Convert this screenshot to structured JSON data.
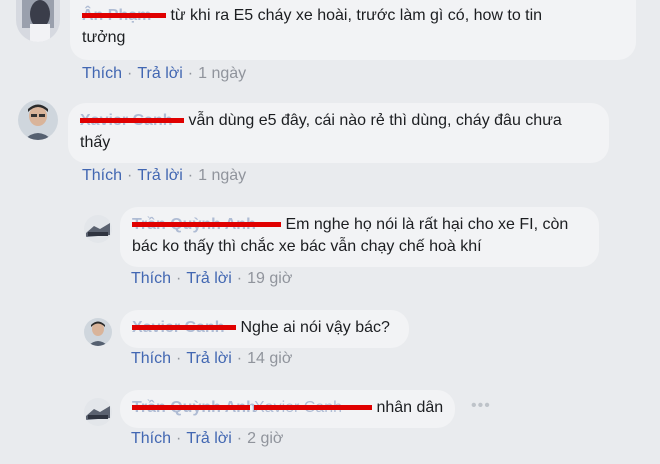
{
  "comments": [
    {
      "author": "Ân Phạm",
      "text_line1": "từ khi ra E5 cháy xe hoài, trước làm gì có, how to tin",
      "text_line2": "tưởng",
      "like": "Thích",
      "reply": "Trả lời",
      "time": "1 ngày"
    },
    {
      "author": "Xavier Canh",
      "text_line1": "vẫn dùng e5 đây, cái nào rẻ thì dùng, cháy đâu chưa",
      "text_line2": "thấy",
      "like": "Thích",
      "reply": "Trả lời",
      "time": "1 ngày"
    }
  ],
  "replies": [
    {
      "author": "Trần Quỳnh Anh",
      "text_line1": "Em nghe họ nói là rất hại cho xe FI, còn",
      "text_line2": "bác ko thấy thì chắc xe bác vẫn chạy chế hoà khí",
      "like": "Thích",
      "reply": "Trả lời",
      "time": "19 giờ"
    },
    {
      "author": "Xavier Canh",
      "text_line1": "Nghe ai nói vậy bác?",
      "like": "Thích",
      "reply": "Trả lời",
      "time": "14 giờ"
    },
    {
      "author": "Trần Quỳnh Anh",
      "tag": "Xavier Canh",
      "text_line1": "nhân dân",
      "like": "Thích",
      "reply": "Trả lời",
      "time": "2 giờ",
      "more_icon": "more-options-icon"
    }
  ],
  "separator": "·",
  "colors": {
    "background": "#e9ebee",
    "bubble": "#f2f3f5",
    "link": "#4267b2",
    "redaction": "#e00000"
  }
}
